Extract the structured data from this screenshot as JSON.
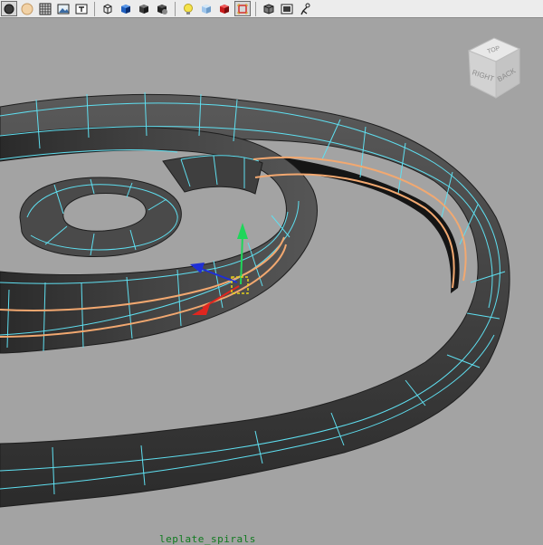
{
  "app": {
    "panel": "3D viewport"
  },
  "toolbar": {
    "groups": [
      [
        "isolate-select-icon",
        "sphere-shaded-icon",
        "wireframe-grid-icon",
        "image-plane-icon",
        "text-field-icon"
      ],
      [
        "wireframe-cube-icon",
        "smooth-shade-cube-icon",
        "shaded-dark-cube-icon",
        "default-material-icon"
      ],
      [
        "light-bulb-icon",
        "textured-cube-icon",
        "red-cube-icon",
        "frame-selected-icon"
      ],
      [
        "xray-cube-icon",
        "film-gate-icon",
        "joint-tool-icon"
      ]
    ]
  },
  "viewcube": {
    "faces": [
      "TOP",
      "RIGHT",
      "BACK"
    ]
  },
  "hud": {
    "object_name": "leplate_spirals"
  },
  "colors": {
    "viewport_bg": "#a3a3a3",
    "mesh": "#404040",
    "wire": "#5fdff0",
    "edge_selection": "#f2a870",
    "manip_y": "#1fd65a",
    "manip_x": "#e0261f",
    "manip_z": "#1f2fd6",
    "pivot": "#e6d21a"
  }
}
